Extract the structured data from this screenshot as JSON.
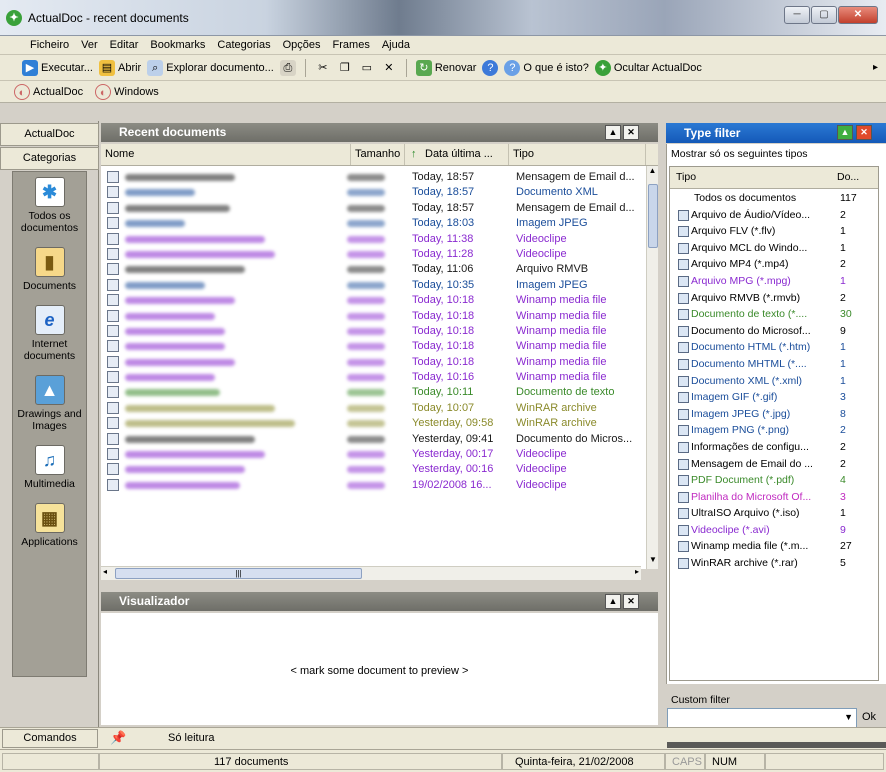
{
  "window": {
    "title": "ActualDoc - recent documents"
  },
  "menu": [
    "Ficheiro",
    "Ver",
    "Editar",
    "Bookmarks",
    "Categorias",
    "Opções",
    "Frames",
    "Ajuda"
  ],
  "toolbar": {
    "executar": "Executar...",
    "abrir": "Abrir",
    "explorar": "Explorar documento...",
    "renovar": "Renovar",
    "o_que_e": "O que é isto?",
    "ocultar": "Ocultar ActualDoc"
  },
  "toolbar2": {
    "actualdoc": "ActualDoc",
    "windows": "Windows"
  },
  "left_tabs": {
    "actualdoc": "ActualDoc",
    "categorias": "Categorias",
    "comandos": "Comandos"
  },
  "nav": [
    {
      "label": "Todos os documentos",
      "icon": "all-documents-icon"
    },
    {
      "label": "Documents",
      "icon": "documents-icon"
    },
    {
      "label": "Internet documents",
      "icon": "internet-icon"
    },
    {
      "label": "Drawings and Images",
      "icon": "image-icon"
    },
    {
      "label": "Multimedia",
      "icon": "multimedia-icon"
    },
    {
      "label": "Applications",
      "icon": "applications-icon"
    }
  ],
  "recent": {
    "title": "Recent documents",
    "columns": {
      "name": "Nome",
      "size": "Tamanho",
      "date": "Data última ...",
      "type": "Tipo"
    },
    "rows": [
      {
        "date": "Today, 18:57",
        "type": "Mensagem de Email d..."
      },
      {
        "date": "Today, 18:57",
        "type": "Documento XML"
      },
      {
        "date": "Today, 18:57",
        "type": "Mensagem de Email d..."
      },
      {
        "date": "Today, 18:03",
        "type": "Imagem JPEG"
      },
      {
        "date": "Today, 11:38",
        "type": "Videoclipe"
      },
      {
        "date": "Today, 11:28",
        "type": "Videoclipe"
      },
      {
        "date": "Today, 11:06",
        "type": "Arquivo RMVB"
      },
      {
        "date": "Today, 10:35",
        "type": "Imagem JPEG"
      },
      {
        "date": "Today, 10:18",
        "type": "Winamp media file"
      },
      {
        "date": "Today, 10:18",
        "type": "Winamp media file"
      },
      {
        "date": "Today, 10:18",
        "type": "Winamp media file"
      },
      {
        "date": "Today, 10:18",
        "type": "Winamp media file"
      },
      {
        "date": "Today, 10:18",
        "type": "Winamp media file"
      },
      {
        "date": "Today, 10:16",
        "type": "Winamp media file"
      },
      {
        "date": "Today, 10:11",
        "type": "Documento de texto"
      },
      {
        "date": "Today, 10:07",
        "type": "WinRAR archive"
      },
      {
        "date": "Yesterday, 09:58",
        "type": "WinRAR archive"
      },
      {
        "date": "Yesterday, 09:41",
        "type": "Documento do Micros..."
      },
      {
        "date": "Yesterday, 00:17",
        "type": "Videoclipe"
      },
      {
        "date": "Yesterday, 00:16",
        "type": "Videoclipe"
      },
      {
        "date": "19/02/2008 16...",
        "type": "Videoclipe"
      }
    ]
  },
  "preview": {
    "title": "Visualizador",
    "message": "< mark some document to preview >"
  },
  "filter": {
    "title": "Type filter",
    "subtitle": "Mostrar só os seguintes tipos",
    "col_type": "Tipo",
    "col_count": "Do...",
    "items": [
      {
        "label": "Todos os documentos",
        "count": "117"
      },
      {
        "label": "Arquivo de Áudio/Vídeo...",
        "count": "2"
      },
      {
        "label": "Arquivo FLV (*.flv)",
        "count": "1"
      },
      {
        "label": "Arquivo MCL do Windo...",
        "count": "1"
      },
      {
        "label": "Arquivo MP4 (*.mp4)",
        "count": "2"
      },
      {
        "label": "Arquivo MPG (*.mpg)",
        "count": "1"
      },
      {
        "label": "Arquivo RMVB (*.rmvb)",
        "count": "2"
      },
      {
        "label": "Documento de texto (*....",
        "count": "30"
      },
      {
        "label": "Documento do Microsof...",
        "count": "9"
      },
      {
        "label": "Documento HTML (*.htm)",
        "count": "1"
      },
      {
        "label": "Documento MHTML (*....",
        "count": "1"
      },
      {
        "label": "Documento XML (*.xml)",
        "count": "1"
      },
      {
        "label": "Imagem GIF (*.gif)",
        "count": "3"
      },
      {
        "label": "Imagem JPEG (*.jpg)",
        "count": "8"
      },
      {
        "label": "Imagem PNG (*.png)",
        "count": "2"
      },
      {
        "label": "Informações de configu...",
        "count": "2"
      },
      {
        "label": "Mensagem de Email do ...",
        "count": "2"
      },
      {
        "label": "PDF Document (*.pdf)",
        "count": "4"
      },
      {
        "label": "Planilha do Microsoft Of...",
        "count": "3"
      },
      {
        "label": "UltraISO Arquivo (*.iso)",
        "count": "1"
      },
      {
        "label": "Videoclipe (*.avi)",
        "count": "9"
      },
      {
        "label": "Winamp media file (*.m...",
        "count": "27"
      },
      {
        "label": "WinRAR archive (*.rar)",
        "count": "5"
      }
    ],
    "custom_label": "Custom filter",
    "ok": "Ok"
  },
  "commands": {
    "readonly": "Só leitura"
  },
  "status": {
    "count": "117 documents",
    "date": "Quinta-feira, 21/02/2008",
    "caps": "CAPS",
    "num": "NUM"
  }
}
